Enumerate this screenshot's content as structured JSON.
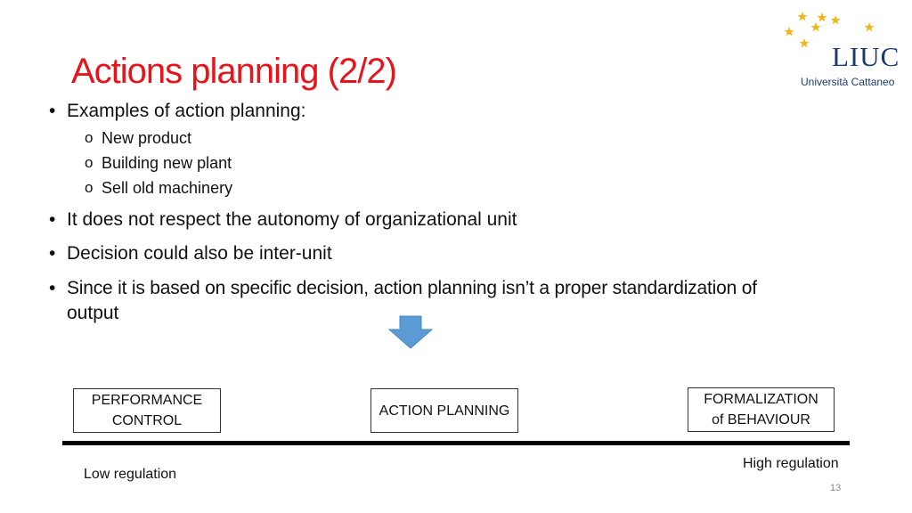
{
  "slide": {
    "title": "Actions planning (2/2)",
    "bullets": [
      {
        "text": "Examples of action planning:",
        "sub": [
          "New product",
          "Building new plant",
          "Sell old machinery"
        ]
      },
      {
        "text": "It does not respect the autonomy of organizational unit"
      },
      {
        "text": "Decision could also be inter-unit"
      },
      {
        "text": "Since it is based on specific decision, action planning isn’t a proper standardization of",
        "continuation": "output"
      }
    ],
    "bullet_glyph": "•",
    "sub_bullet_glyph": "o",
    "scale": {
      "boxes": [
        {
          "line1": "PERFORMANCE",
          "line2": "CONTROL"
        },
        {
          "line1": "ACTION PLANNING"
        },
        {
          "line1": "FORMALIZATION",
          "line2": "of BEHAVIOUR"
        }
      ],
      "low_label": "Low regulation",
      "high_label": "High regulation"
    },
    "page_number": "13"
  },
  "logo": {
    "name": "LIUC",
    "subtitle": "Università Cattaneo",
    "star_color": "#f2b51c",
    "text_color": "#1a3a6e"
  },
  "colors": {
    "title": "#e8141c",
    "arrow": "#5b9bd5"
  }
}
